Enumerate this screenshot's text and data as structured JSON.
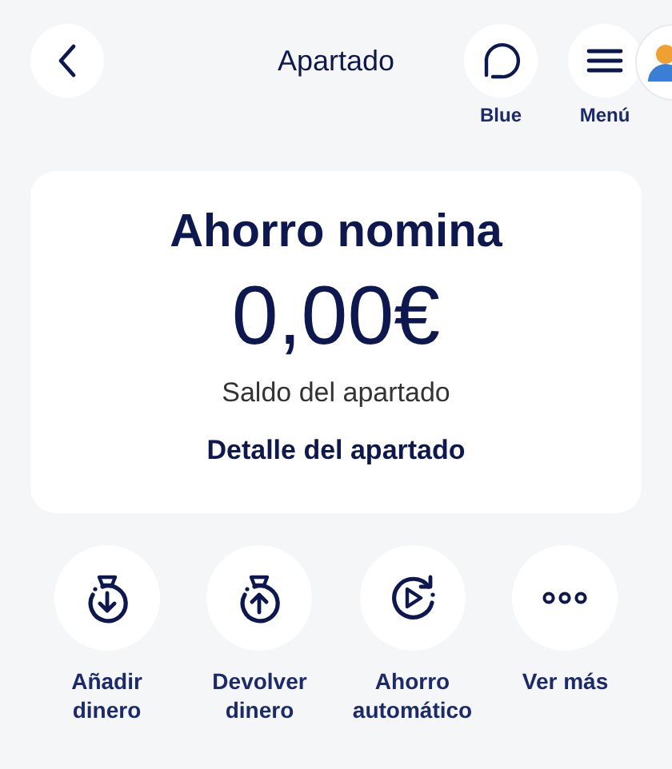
{
  "header": {
    "title": "Apartado",
    "buttons": [
      {
        "kind": "chat",
        "label": "Blue"
      },
      {
        "kind": "menu",
        "label": "Menú"
      }
    ]
  },
  "card": {
    "name": "Ahorro nomina",
    "balance": "0,00€",
    "caption": "Saldo del apartado",
    "link": "Detalle del apartado"
  },
  "actions": [
    {
      "kind": "add",
      "label": "Añadir dinero"
    },
    {
      "kind": "return",
      "label": "Devolver dinero"
    },
    {
      "kind": "auto",
      "label": "Ahorro automático"
    },
    {
      "kind": "more",
      "label": "Ver más"
    }
  ]
}
